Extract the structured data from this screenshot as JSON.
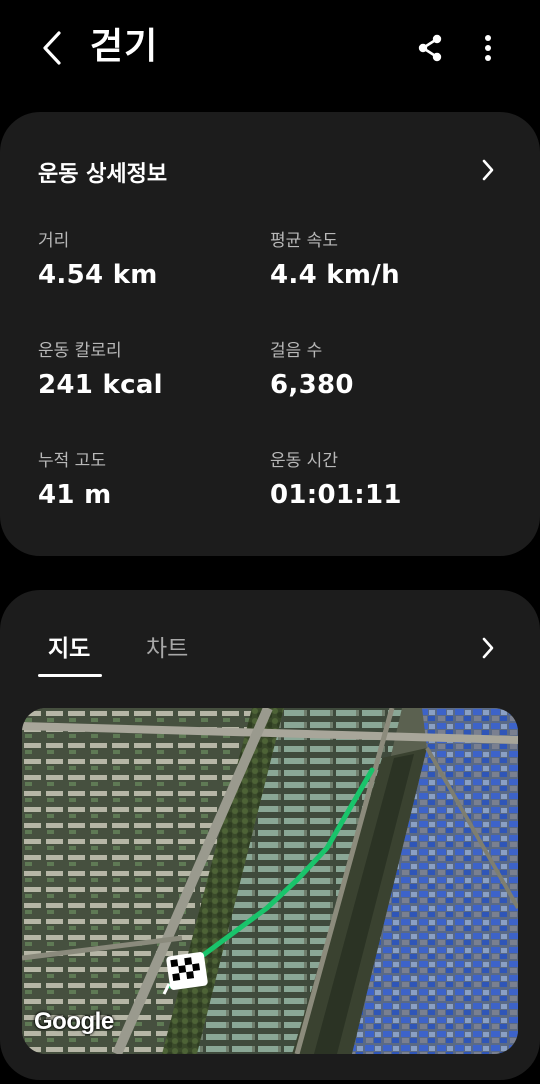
{
  "header": {
    "title": "걷기",
    "icons": {
      "back": "back-arrow-icon",
      "share": "share-icon",
      "more": "more-vertical-icon"
    }
  },
  "details": {
    "heading": "운동 상세정보",
    "stats": [
      {
        "label": "거리",
        "value": "4.54 km"
      },
      {
        "label": "평균 속도",
        "value": "4.4 km/h"
      },
      {
        "label": "운동 칼로리",
        "value": "241 kcal"
      },
      {
        "label": "걸음 수",
        "value": "6,380"
      },
      {
        "label": "누적 고도",
        "value": "41 m"
      },
      {
        "label": "운동 시간",
        "value": "01:01:11"
      }
    ]
  },
  "map_section": {
    "tabs": [
      {
        "label": "지도",
        "selected": true
      },
      {
        "label": "차트",
        "selected": false
      }
    ],
    "attribution": "Google",
    "route_color": "#19c46b"
  },
  "colors": {
    "background": "#000000",
    "card": "#1c1c1c",
    "label": "#b8b8b8"
  }
}
